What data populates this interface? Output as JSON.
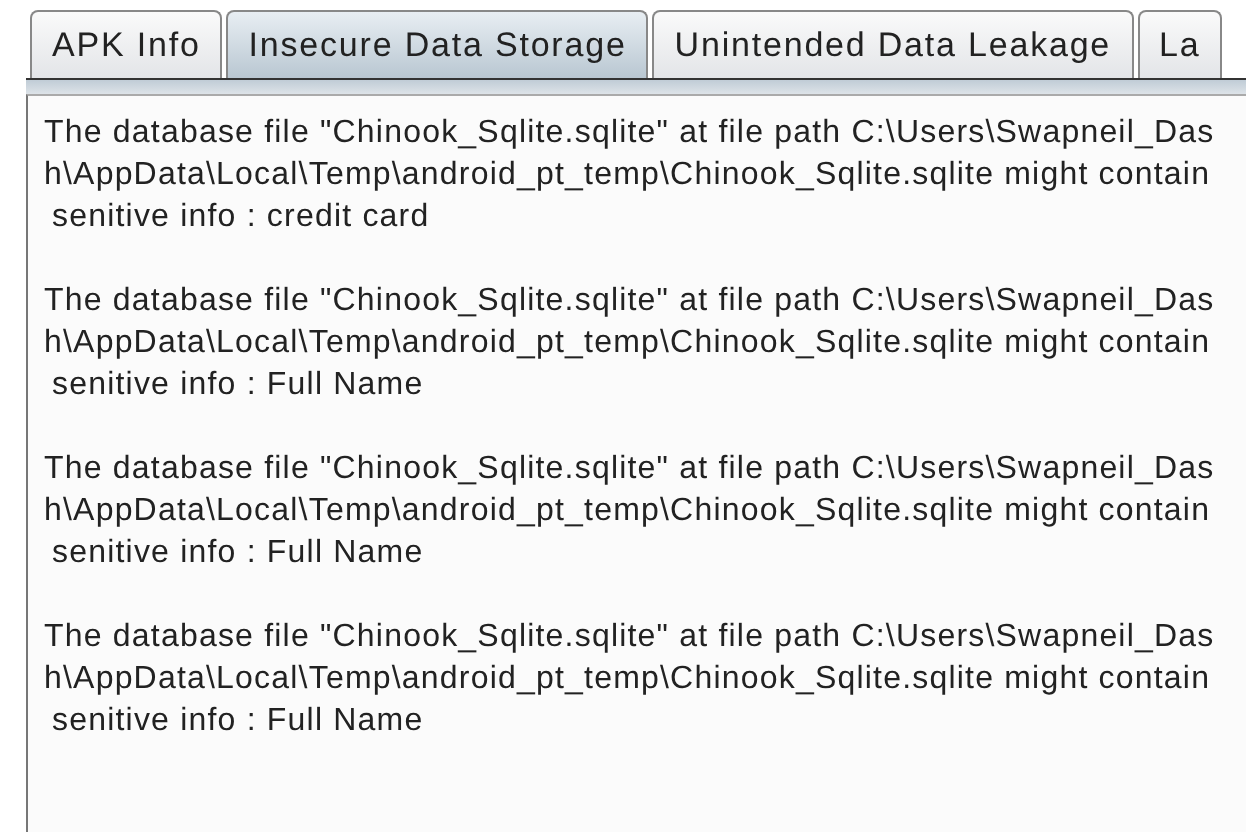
{
  "tabs": [
    {
      "label": "APK Info",
      "selected": false
    },
    {
      "label": "Insecure Data Storage",
      "selected": true
    },
    {
      "label": "Unintended Data Leakage",
      "selected": false
    },
    {
      "label": "La",
      "selected": false
    }
  ],
  "findings": [
    {
      "lines": [
        "The database file \"Chinook_Sqlite.sqlite\" at file path C:\\Users\\Swapneil_Das",
        "h\\AppData\\Local\\Temp\\android_pt_temp\\Chinook_Sqlite.sqlite might contain",
        "senitive info : credit card"
      ]
    },
    {
      "lines": [
        "The database file \"Chinook_Sqlite.sqlite\" at file path C:\\Users\\Swapneil_Das",
        "h\\AppData\\Local\\Temp\\android_pt_temp\\Chinook_Sqlite.sqlite might contain",
        "senitive info : Full Name"
      ]
    },
    {
      "lines": [
        "The database file \"Chinook_Sqlite.sqlite\" at file path C:\\Users\\Swapneil_Das",
        "h\\AppData\\Local\\Temp\\android_pt_temp\\Chinook_Sqlite.sqlite might contain",
        "senitive info : Full Name"
      ]
    },
    {
      "lines": [
        "The database file \"Chinook_Sqlite.sqlite\" at file path C:\\Users\\Swapneil_Das",
        "h\\AppData\\Local\\Temp\\android_pt_temp\\Chinook_Sqlite.sqlite might contain",
        "senitive info : Full Name"
      ]
    }
  ]
}
